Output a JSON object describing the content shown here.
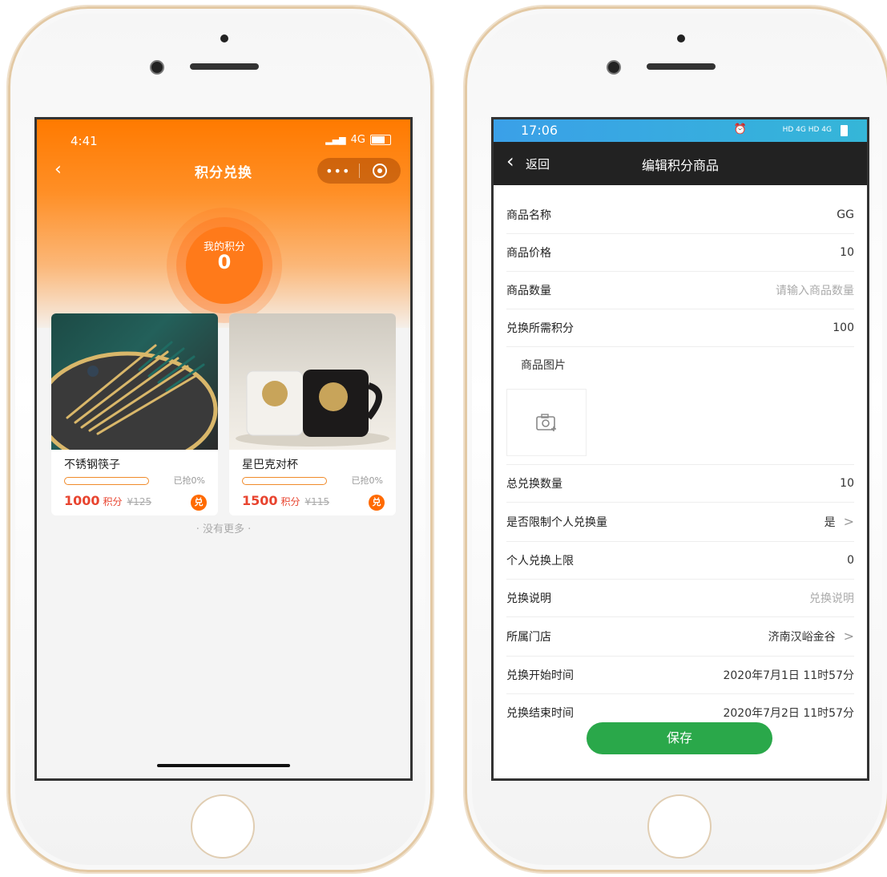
{
  "left_phone": {
    "status_time": "4:41",
    "status_network": "4G",
    "title": "积分兑换",
    "capsule_dots": "•••",
    "my_points_label": "我的积分",
    "my_points_value": "0",
    "products": [
      {
        "name": "不锈钢筷子",
        "sold": "已抢0%",
        "points": "1000",
        "points_unit": "积分",
        "original_price": "¥125",
        "badge": "兑"
      },
      {
        "name": "星巴克对杯",
        "sold": "已抢0%",
        "points": "1500",
        "points_unit": "积分",
        "original_price": "¥115",
        "badge": "兑"
      }
    ],
    "no_more": "· 没有更多 ·"
  },
  "right_phone": {
    "status_time": "17:06",
    "status_icons": "HD 4G HD 4G",
    "back_label": "返回",
    "title": "编辑积分商品",
    "fields": [
      {
        "label": "商品名称",
        "value": "GG"
      },
      {
        "label": "商品价格",
        "value": "10"
      },
      {
        "label": "商品数量",
        "placeholder": "请输入商品数量"
      },
      {
        "label": "兑换所需积分",
        "value": "100"
      },
      {
        "label": "商品图片"
      },
      {
        "label": "总兑换数量",
        "value": "10"
      },
      {
        "label": "是否限制个人兑换量",
        "value": "是"
      },
      {
        "label": "个人兑换上限",
        "value": "0"
      },
      {
        "label": "兑换说明",
        "placeholder": "兑换说明"
      },
      {
        "label": "所属门店",
        "value": "济南汉峪金谷"
      },
      {
        "label": "兑换开始时间",
        "value": "2020年7月1日 11时57分"
      },
      {
        "label": "兑换结束时间",
        "value": "2020年7月2日 11时57分"
      }
    ],
    "save_label": "保存"
  },
  "colors": {
    "accent_orange": "#ff7a00",
    "price_red": "#e8442f",
    "save_green": "#2aa84a",
    "status_blue": "#3aa0e8"
  }
}
